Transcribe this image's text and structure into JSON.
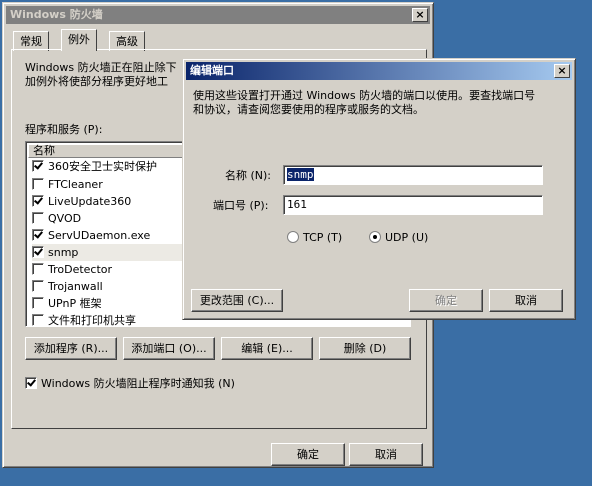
{
  "main_window": {
    "title": "Windows 防火墙",
    "close_glyph": "×",
    "tabs": [
      {
        "label": "常规"
      },
      {
        "label": "例外"
      },
      {
        "label": "高级"
      }
    ],
    "description_line1": "Windows 防火墙正在阻止除下",
    "description_line2": "加例外将使部分程序更好地工",
    "programs_label": "程序和服务 (P):",
    "list_header": "名称",
    "programs": [
      {
        "name": "360安全卫士实时保护",
        "checked": true
      },
      {
        "name": "FTCleaner",
        "checked": false
      },
      {
        "name": "LiveUpdate360",
        "checked": true
      },
      {
        "name": "QVOD",
        "checked": false
      },
      {
        "name": "ServUDaemon.exe",
        "checked": true
      },
      {
        "name": "snmp",
        "checked": true,
        "selected": true
      },
      {
        "name": "TroDetector",
        "checked": false
      },
      {
        "name": "Trojanwall",
        "checked": false
      },
      {
        "name": "UPnP 框架",
        "checked": false
      },
      {
        "name": "文件和打印机共享",
        "checked": false
      }
    ],
    "buttons": {
      "add_program": "添加程序 (R)...",
      "add_port": "添加端口 (O)...",
      "edit": "编辑 (E)...",
      "delete": "删除 (D)"
    },
    "notify_label": "Windows 防火墙阻止程序时通知我 (N)",
    "notify_checked": true,
    "ok": "确定",
    "cancel": "取消"
  },
  "edit_port_dialog": {
    "title": "编辑端口",
    "close_glyph": "×",
    "description_line1": "使用这些设置打开通过 Windows 防火墙的端口以使用。要查找端口号",
    "description_line2": "和协议，请查阅您要使用的程序或服务的文档。",
    "name_label": "名称 (N):",
    "name_value": "snmp",
    "port_label": "端口号 (P):",
    "port_value": "161",
    "protocol": {
      "tcp_label": "TCP (T)",
      "udp_label": "UDP (U)",
      "selected": "UDP"
    },
    "change_scope": "更改范围 (C)...",
    "ok": "确定",
    "cancel": "取消"
  }
}
